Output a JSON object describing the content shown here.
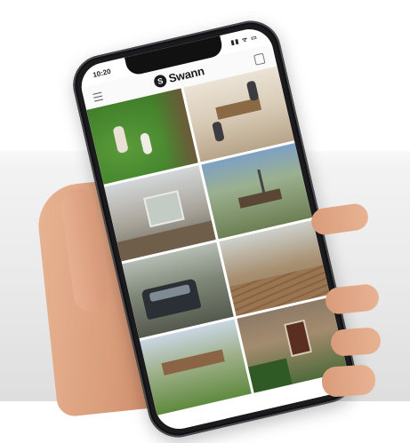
{
  "status_bar": {
    "time": "10:20",
    "icons": "▮▮ ᯤ ▭"
  },
  "app": {
    "logo_mark": "S",
    "logo_text": "Swann"
  },
  "camera_tiles": [
    "backyard-lawn-kids",
    "living-room-family",
    "covered-patio",
    "garden-dining-set",
    "driveway-suv",
    "wooden-deck",
    "garden-fence-lawn",
    "front-porch-door"
  ]
}
